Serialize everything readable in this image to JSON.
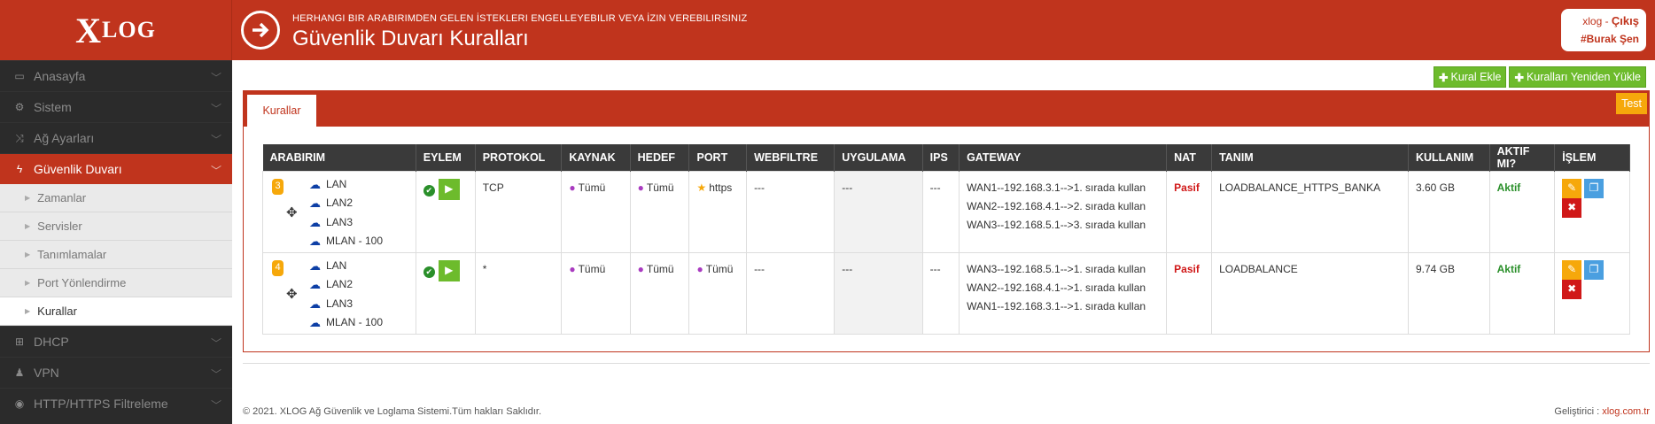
{
  "sidebar": {
    "logo": "XLOG",
    "items": [
      {
        "label": "Anasayfa",
        "icon": "laptop-icon"
      },
      {
        "label": "Sistem",
        "icon": "cogs-icon"
      },
      {
        "label": "Ağ Ayarları",
        "icon": "shuffle-icon"
      },
      {
        "label": "Güvenlik Duvarı",
        "icon": "bolt-icon"
      }
    ],
    "subitems": [
      "Zamanlar",
      "Servisler",
      "Tanımlamalar",
      "Port Yönlendirme",
      "Kurallar"
    ],
    "items2": [
      {
        "label": "DHCP",
        "icon": "sitemap-icon"
      },
      {
        "label": "VPN",
        "icon": "user-secret-icon"
      },
      {
        "label": "HTTP/HTTPS Filtreleme",
        "icon": "eye-slash-icon"
      }
    ]
  },
  "header": {
    "subtitle": "HERHANGI BIR ARABIRIMDEN GELEN İSTEKLERI ENGELLEYEBILIR VEYA İZIN VEREBILIRSINIZ",
    "title": "Güvenlik Duvarı Kuralları",
    "user_prefix": "xlog - ",
    "logout": "Çıkış",
    "username": "#Burak Şen"
  },
  "actions": {
    "add": "Kural Ekle",
    "reload": "Kuralları Yeniden Yükle",
    "test": "Test"
  },
  "tab": "Kurallar",
  "table": {
    "headers": [
      "ARABIRIM",
      "EYLEM",
      "PROTOKOL",
      "KAYNAK",
      "HEDEF",
      "PORT",
      "WEBFILTRE",
      "UYGULAMA",
      "IPS",
      "GATEWAY",
      "NAT",
      "TANIM",
      "KULLANIM",
      "AKTIF MI?",
      "İŞLEM"
    ],
    "rows": [
      {
        "order": "3",
        "interfaces": [
          "LAN",
          "LAN2",
          "LAN3",
          "MLAN - 100"
        ],
        "protocol": "TCP",
        "source": "Tümü",
        "dest": "Tümü",
        "port": "https",
        "webfilter": "---",
        "app": "---",
        "ips": "---",
        "gateway": [
          "WAN1--192.168.3.1-->1. sırada kullan",
          "WAN2--192.168.4.1-->2. sırada kullan",
          "WAN3--192.168.5.1-->3. sırada kullan"
        ],
        "nat": "Pasif",
        "desc": "LOADBALANCE_HTTPS_BANKA",
        "usage": "3.60 GB",
        "active": "Aktif"
      },
      {
        "order": "4",
        "interfaces": [
          "LAN",
          "LAN2",
          "LAN3",
          "MLAN - 100"
        ],
        "protocol": "*",
        "source": "Tümü",
        "dest": "Tümü",
        "port": "Tümü",
        "webfilter": "---",
        "app": "---",
        "ips": "---",
        "gateway": [
          "WAN3--192.168.5.1-->1. sırada kullan",
          "WAN2--192.168.4.1-->1. sırada kullan",
          "WAN1--192.168.3.1-->1. sırada kullan"
        ],
        "nat": "Pasif",
        "desc": "LOADBALANCE",
        "usage": "9.74 GB",
        "active": "Aktif"
      }
    ]
  },
  "footer": {
    "copyright": "© 2021. XLOG Ağ Güvenlik ve Loglama Sistemi.Tüm hakları Saklıdır.",
    "dev_label": "Geliştirici : ",
    "dev_link": "xlog.com.tr"
  },
  "colors": {
    "brand": "#c0341d",
    "sidebar": "#2b2b2b",
    "green": "#6dbb2c",
    "orange": "#f6a80b"
  }
}
